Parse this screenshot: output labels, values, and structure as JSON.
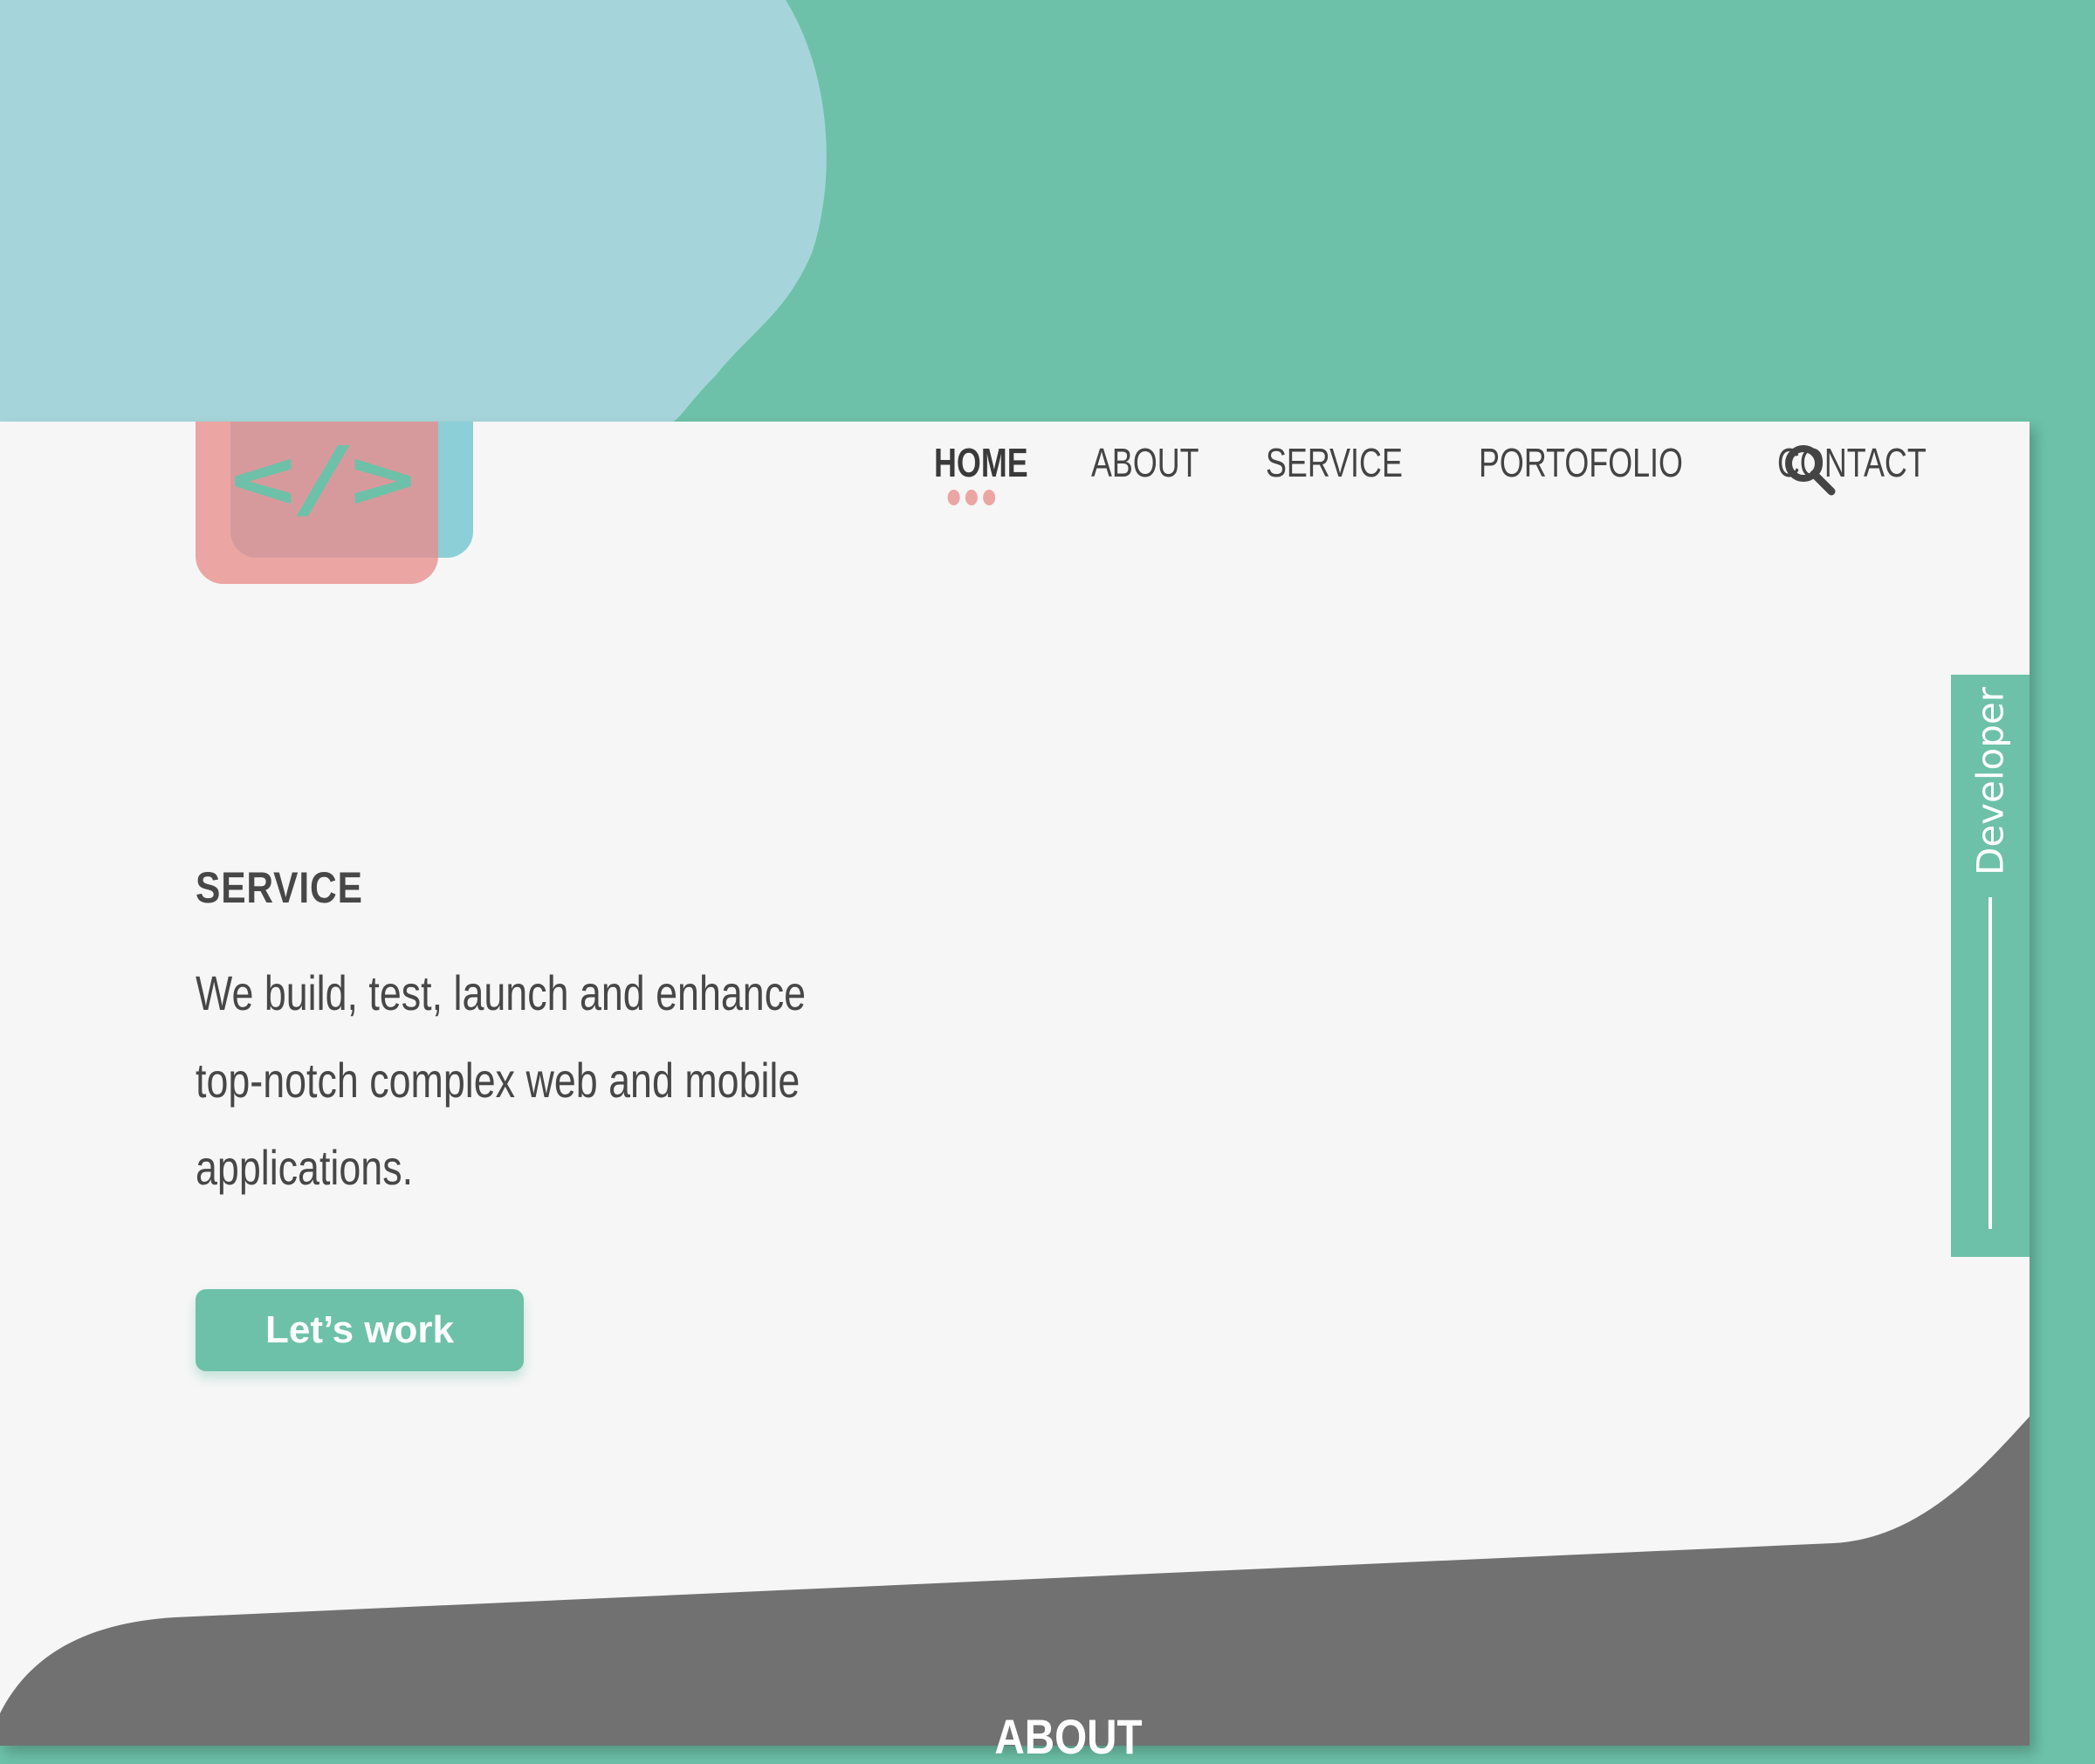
{
  "logo": {
    "glyph": "</>"
  },
  "nav": {
    "items": [
      {
        "label": "HOME",
        "active": true
      },
      {
        "label": "ABOUT",
        "active": false
      },
      {
        "label": "SERVICE",
        "active": false
      },
      {
        "label": "PORTOFOLIO",
        "active": false
      },
      {
        "label": "CONTACT",
        "active": false
      }
    ],
    "search_icon": "search-icon"
  },
  "hero": {
    "title": "SERVICE",
    "text": "We build, test, launch and enhance top-notch complex web and mobile applications.",
    "cta_label": "Let’s work"
  },
  "side_tab": {
    "label": "Developer"
  },
  "about": {
    "heading": "ABOUT"
  },
  "colors": {
    "teal": "#6dc1a8",
    "light_blue": "#a5d5da",
    "pink": "#eba5a3",
    "dark_gray": "#717171",
    "page_bg": "#f6f6f6"
  }
}
